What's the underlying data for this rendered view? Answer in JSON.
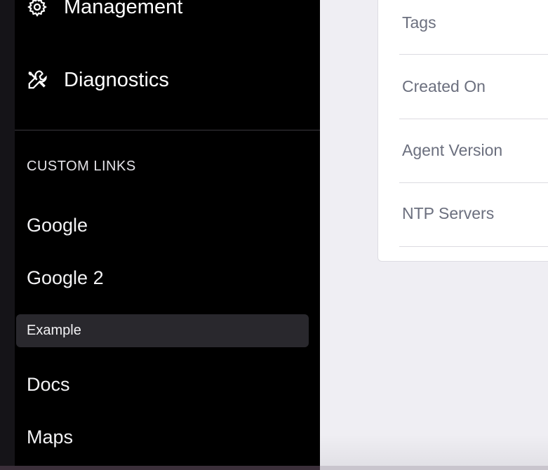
{
  "sidebar": {
    "nav": [
      {
        "label": "Management",
        "icon": "gear-icon"
      },
      {
        "label": "Diagnostics",
        "icon": "tools-icon"
      }
    ],
    "custom_links_heading": "CUSTOM LINKS",
    "custom_links": [
      {
        "label": "Google"
      },
      {
        "label": "Google 2"
      },
      {
        "label": "Example",
        "active": true
      },
      {
        "label": "Docs"
      },
      {
        "label": "Maps"
      }
    ]
  },
  "details": {
    "rows": [
      {
        "label": "Tags"
      },
      {
        "label": "Created On"
      },
      {
        "label": "Agent Version"
      },
      {
        "label": "NTP Servers"
      }
    ]
  },
  "colors": {
    "sidebar_bg": "#000000",
    "active_item_bg": "#29282d",
    "content_bg": "#efeef3",
    "row_label": "#6b6f7e"
  }
}
